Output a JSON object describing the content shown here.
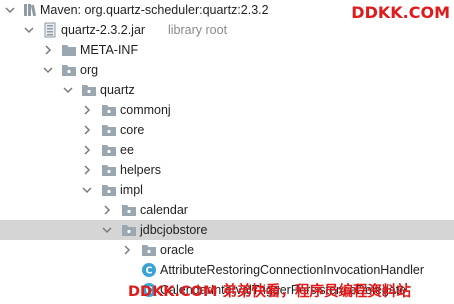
{
  "tree": {
    "root": {
      "label": "Maven: org.quartz-scheduler:quartz:2.3.2"
    },
    "jar": {
      "label": "quartz-2.3.2.jar",
      "note": "library root"
    },
    "meta_inf": {
      "label": "META-INF"
    },
    "org": {
      "label": "org"
    },
    "quartz": {
      "label": "quartz"
    },
    "commonj": {
      "label": "commonj"
    },
    "core": {
      "label": "core"
    },
    "ee": {
      "label": "ee"
    },
    "helpers": {
      "label": "helpers"
    },
    "impl": {
      "label": "impl"
    },
    "calendar": {
      "label": "calendar"
    },
    "jdbcjobstore": {
      "label": "jdbcjobstore"
    },
    "oracle": {
      "label": "oracle"
    },
    "class_item": {
      "label": "AttributeRestoringConnectionInvocationHandler"
    },
    "partial_class": {
      "label": "CalendarIntervalTriggerPersistenceDelegate"
    }
  },
  "watermark": {
    "top": "DDKK.COM",
    "bottom": "DDKK.COM 弟弟快看，程序员编程资料站"
  },
  "colors": {
    "folder": "#9aa7b0",
    "class_icon": "#3ba3d4",
    "selection": "#d5d5d5",
    "watermark": "#e11b1b"
  }
}
